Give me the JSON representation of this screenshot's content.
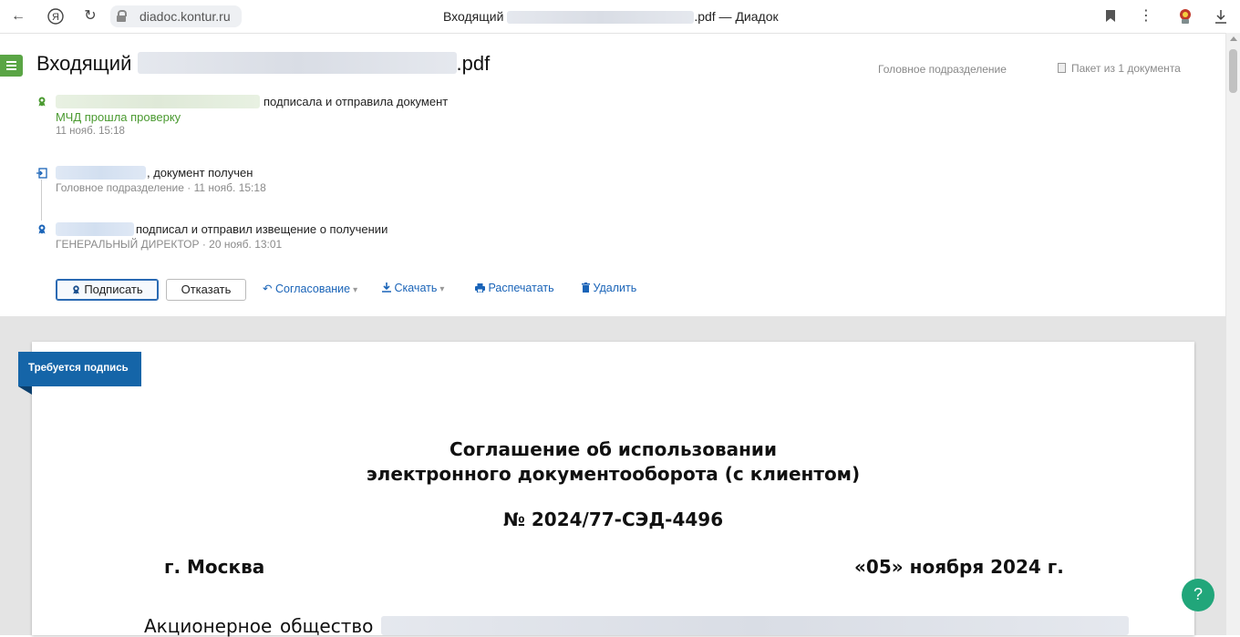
{
  "browser": {
    "url": "diadoc.kontur.ru",
    "title_prefix": "Входящий",
    "title_suffix": ".pdf — Диадок"
  },
  "header": {
    "title_prefix": "Входящий",
    "title_suffix": ".pdf",
    "department": "Головное подразделение",
    "packet": "Пакет из 1 документа"
  },
  "events": [
    {
      "text": "подписала и отправила документ",
      "status": "МЧД прошла проверку",
      "meta": "11 нояб. 15:18"
    },
    {
      "text": ", документ получен",
      "meta": "Головное подразделение  ·  11 нояб. 15:18"
    },
    {
      "text": "подписал и отправил извещение о получении",
      "meta": "ГЕНЕРАЛЬНЫЙ ДИРЕКТОР  ·  20 нояб. 13:01"
    }
  ],
  "actions": {
    "sign": "Подписать",
    "reject": "Отказать",
    "approval": "Согласование",
    "download": "Скачать",
    "print": "Распечатать",
    "delete": "Удалить"
  },
  "colors": {
    "brand_green": "#5aa545",
    "link_blue": "#1a64b8",
    "ribbon_blue": "#1565a8",
    "help_green": "#21a67a"
  },
  "document": {
    "ribbon": "Требуется подпись",
    "title_line1": "Соглашение об использовании",
    "title_line2": "электронного документооборота (с клиентом)",
    "number": "№ 2024/77-СЭД-4496",
    "city": "г. Москва",
    "date": "«05» ноября 2024 г.",
    "body_start_1": "Акционерное",
    "body_start_2": "общество"
  },
  "help": "?"
}
